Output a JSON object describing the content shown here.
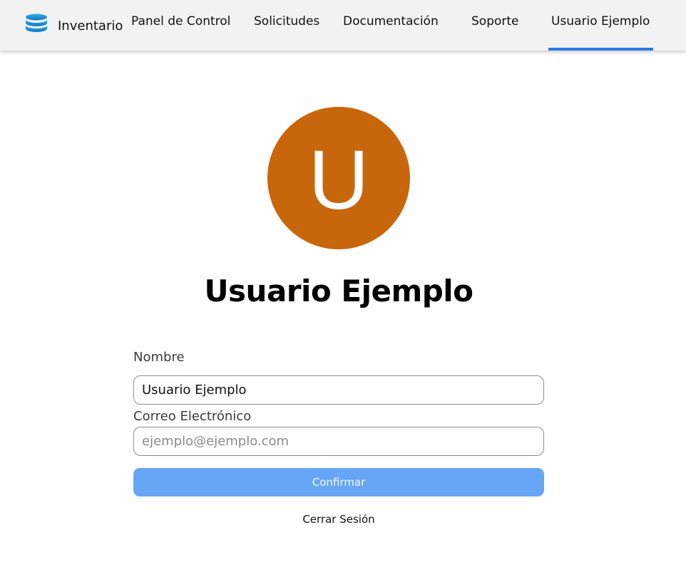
{
  "navbar": {
    "brand": {
      "label": "Inventario",
      "icon": "database-icon",
      "icon_color": "#1c93d6"
    },
    "items": [
      {
        "label": "Panel de Control"
      },
      {
        "label": "Solicitudes"
      },
      {
        "label": "Documentación"
      },
      {
        "label": "Soporte"
      },
      {
        "label": "Usuario Ejemplo",
        "active": true
      }
    ],
    "active_color": "#2a7ae2"
  },
  "profile": {
    "avatar_letter": "U",
    "avatar_color": "#c8660c",
    "name": "Usuario Ejemplo"
  },
  "form": {
    "name_label": "Nombre",
    "name_value": "Usuario Ejemplo",
    "email_label": "Correo Electrónico",
    "email_value": "",
    "email_placeholder": "ejemplo@ejemplo.com",
    "confirm_label": "Confirmar",
    "confirm_color": "#66a6f4"
  },
  "logout_label": "Cerrar Sesión"
}
